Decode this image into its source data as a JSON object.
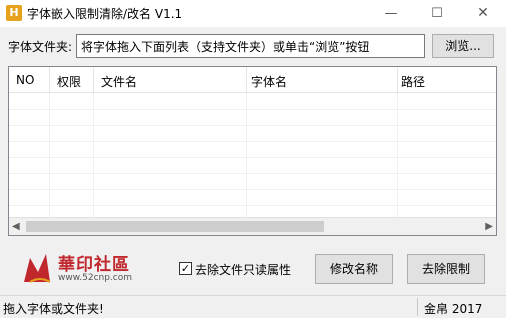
{
  "window": {
    "title": "字体嵌入限制清除/改名 V1.1",
    "controls": {
      "minimize": "—",
      "maximize": "☐",
      "close": "✕"
    },
    "icon": "app-icon"
  },
  "folder": {
    "label": "字体文件夹:",
    "value": "将字体拖入下面列表（支持文件夹）或单击“浏览”按钮",
    "browse_label": "浏览..."
  },
  "list": {
    "columns": [
      "NO",
      "权限",
      "文件名",
      "字体名",
      "路径"
    ],
    "rows": []
  },
  "logo": {
    "text": "華印社區",
    "url": "www.52cnp.com"
  },
  "options": {
    "remove_readonly_label": "去除文件只读属性",
    "remove_readonly_checked": true
  },
  "actions": {
    "rename_label": "修改名称",
    "remove_limit_label": "去除限制"
  },
  "status": {
    "message": "拖入字体或文件夹!",
    "author": "金帛 2017"
  }
}
